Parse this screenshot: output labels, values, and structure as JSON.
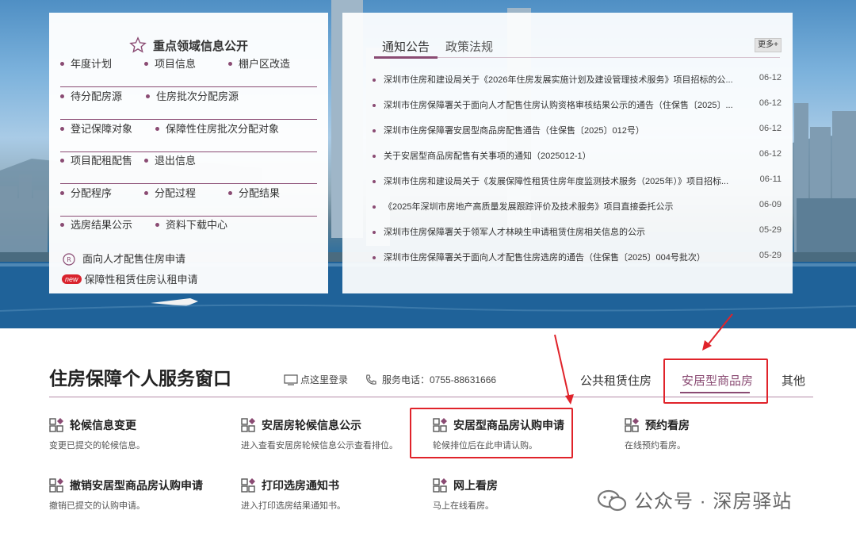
{
  "focus": {
    "title": "重点领域信息公开",
    "rows": [
      [
        "年度计划",
        "项目信息",
        "棚户区改造"
      ],
      [
        "待分配房源",
        "住房批次分配房源"
      ],
      [
        "登记保障对象",
        "保障性住房批次分配对象"
      ],
      [
        "项目配租配售",
        "退出信息"
      ],
      [
        "分配程序",
        "分配过程",
        "分配结果"
      ],
      [
        "选房结果公示",
        "资料下载中心"
      ]
    ],
    "link_talent": "面向人才配售住房申请",
    "new_badge": "new",
    "link_rent": "保障性租赁住房认租申请"
  },
  "notice": {
    "tabs": [
      "通知公告",
      "政策法规"
    ],
    "more": "更多+",
    "items": [
      {
        "title": "深圳市住房和建设局关于《2026年住房发展实施计划及建设管理技术服务》项目招标的公...",
        "date": "06-12"
      },
      {
        "title": "深圳市住房保障署关于面向人才配售住房认购资格审核结果公示的通告（住保售〔2025〕...",
        "date": "06-12"
      },
      {
        "title": "深圳市住房保障署安居型商品房配售通告（住保售〔2025〕012号）",
        "date": "06-12"
      },
      {
        "title": "关于安居型商品房配售有关事项的通知（2025012-1）",
        "date": "06-12"
      },
      {
        "title": "深圳市住房和建设局关于《发展保障性租赁住房年度监测技术服务（2025年）》项目招标...",
        "date": "06-11"
      },
      {
        "title": "《2025年深圳市房地产高质量发展跟踪评价及技术服务》项目直接委托公示",
        "date": "06-09"
      },
      {
        "title": "深圳市住房保障署关于领军人才林映生申请租赁住房相关信息的公示",
        "date": "05-29"
      },
      {
        "title": "深圳市住房保障署关于面向人才配售住房选房的通告（住保售〔2025〕004号批次）",
        "date": "05-29"
      }
    ]
  },
  "service": {
    "title": "住房保障个人服务窗口",
    "login": "点这里登录",
    "phone": "服务电话：0755-88631666",
    "tabs": [
      "公共租赁住房",
      "安居型商品房",
      "其他"
    ],
    "cards": [
      {
        "title": "轮候信息变更",
        "desc": "变更已提交的轮候信息。"
      },
      {
        "title": "安居房轮候信息公示",
        "desc": "进入查看安居房轮候信息公示查看排位。"
      },
      {
        "title": "安居型商品房认购申请",
        "desc": "轮候排位后在此申请认购。"
      },
      {
        "title": "预约看房",
        "desc": "在线预约看房。"
      },
      {
        "title": "撤销安居型商品房认购申请",
        "desc": "撤销已提交的认购申请。"
      },
      {
        "title": "打印选房通知书",
        "desc": "进入打印选房结果通知书。"
      },
      {
        "title": "网上看房",
        "desc": "马上在线看房。"
      }
    ]
  },
  "watermark": "公众号 · 深房驿站",
  "colors": {
    "accent": "#8a4b73",
    "highlight": "#e0232a",
    "new_badge": "#d9232d"
  }
}
